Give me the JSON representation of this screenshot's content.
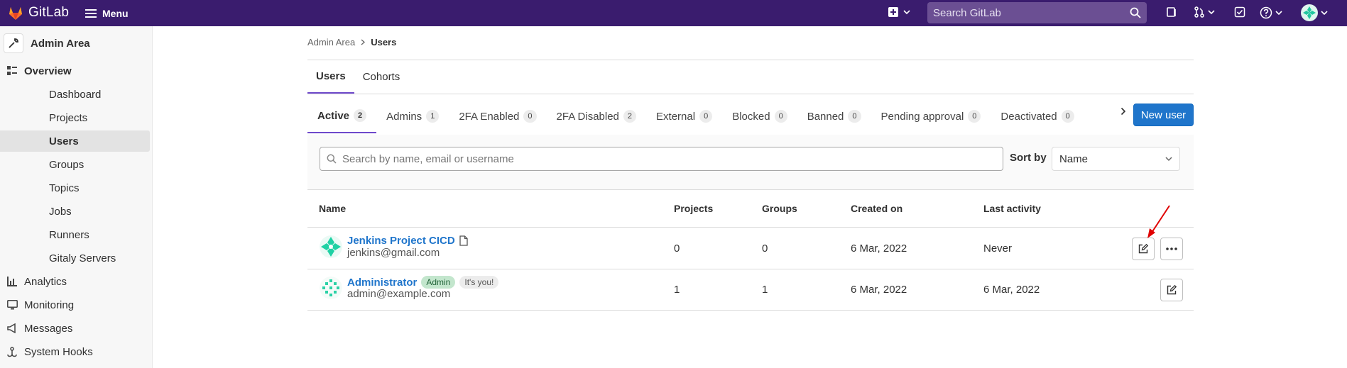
{
  "topbar": {
    "app_name": "GitLab",
    "menu_label": "Menu",
    "search_placeholder": "Search GitLab",
    "colors": {
      "background": "#3a1c6e",
      "search_bg": "#6b4f93"
    },
    "icons": [
      "gitlab-logo-icon",
      "hamburger-icon",
      "plus-square-icon",
      "search-icon",
      "issues-icon",
      "merge-request-icon",
      "todo-icon",
      "help-icon",
      "user-avatar"
    ]
  },
  "sidebar": {
    "title": "Admin Area",
    "items": [
      {
        "label": "Overview",
        "icon": "overview-icon"
      },
      {
        "label": "Dashboard"
      },
      {
        "label": "Projects"
      },
      {
        "label": "Users"
      },
      {
        "label": "Groups"
      },
      {
        "label": "Topics"
      },
      {
        "label": "Jobs"
      },
      {
        "label": "Runners"
      },
      {
        "label": "Gitaly Servers"
      },
      {
        "label": "Analytics",
        "icon": "analytics-icon"
      },
      {
        "label": "Monitoring",
        "icon": "monitoring-icon"
      },
      {
        "label": "Messages",
        "icon": "messages-icon"
      },
      {
        "label": "System Hooks",
        "icon": "hook-icon"
      }
    ]
  },
  "breadcrumb": {
    "parent": "Admin Area",
    "current": "Users"
  },
  "tabs": [
    "Users",
    "Cohorts"
  ],
  "filter_tabs": [
    {
      "label": "Active",
      "count": "2"
    },
    {
      "label": "Admins",
      "count": "1"
    },
    {
      "label": "2FA Enabled",
      "count": "0"
    },
    {
      "label": "2FA Disabled",
      "count": "2"
    },
    {
      "label": "External",
      "count": "0"
    },
    {
      "label": "Blocked",
      "count": "0"
    },
    {
      "label": "Banned",
      "count": "0"
    },
    {
      "label": "Pending approval",
      "count": "0"
    },
    {
      "label": "Deactivated",
      "count": "0"
    }
  ],
  "new_user_label": "New user",
  "search": {
    "placeholder": "Search by name, email or username"
  },
  "sort": {
    "label": "Sort by",
    "value": "Name"
  },
  "table": {
    "headers": [
      "Name",
      "Projects",
      "Groups",
      "Created on",
      "Last activity"
    ],
    "rows": [
      {
        "name": "Jenkins Project CICD",
        "email": "jenkins@gmail.com",
        "projects": "0",
        "groups": "0",
        "created": "6 Mar, 2022",
        "last_activity": "Never"
      },
      {
        "name": "Administrator",
        "badge_admin": "Admin",
        "badge_you": "It's you!",
        "email": "admin@example.com",
        "projects": "1",
        "groups": "1",
        "created": "6 Mar, 2022",
        "last_activity": "6 Mar, 2022"
      }
    ]
  },
  "accent_colors": {
    "primary": "#1f75cb",
    "tab_underline": "#6e49cb",
    "annotation_arrow": "#e00000"
  }
}
